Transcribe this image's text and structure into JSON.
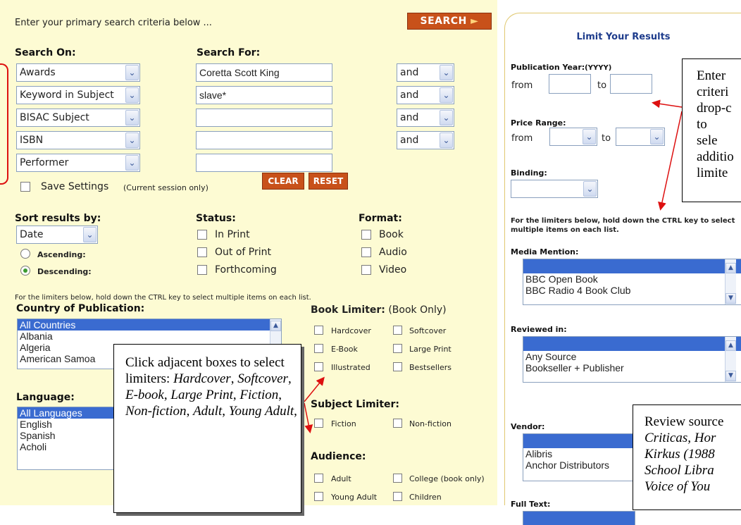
{
  "main": {
    "instruction": "Enter your primary search criteria below ...",
    "search_button": "SEARCH",
    "search_on_header": "Search On:",
    "search_for_header": "Search For:",
    "search_on": [
      "Awards",
      "Keyword in Subject",
      "BISAC Subject",
      "ISBN",
      "Performer"
    ],
    "search_for": [
      "Coretta Scott King",
      "slave*",
      "",
      "",
      ""
    ],
    "operators": [
      "and",
      "and",
      "and",
      "and"
    ],
    "save_settings": "Save Settings",
    "session_note": "(Current session only)",
    "clear_button": "CLEAR",
    "reset_button": "RESET",
    "sort_header": "Sort results by:",
    "sort_value": "Date",
    "ascending": "Ascending:",
    "descending": "Descending:",
    "sort_selected": "Descending",
    "status_header": "Status:",
    "status": [
      "In Print",
      "Out of Print",
      "Forthcoming"
    ],
    "format_header": "Format:",
    "format": [
      "Book",
      "Audio",
      "Video"
    ],
    "limiter_note": "For the limiters below, hold down the CTRL key to select multiple items on each list.",
    "country_header": "Country of Publication:",
    "countries": [
      "All Countries",
      "Albania",
      "Algeria",
      "American Samoa"
    ],
    "language_header": "Language:",
    "languages": [
      "All Languages",
      "English",
      "Spanish",
      "Acholi"
    ],
    "book_limiter_header": "Book Limiter:",
    "book_limiter_sub": "(Book Only)",
    "book_limiters": [
      "Hardcover",
      "Softcover",
      "E-Book",
      "Large Print",
      "Illustrated",
      "Bestsellers"
    ],
    "subject_limiter_header": "Subject Limiter:",
    "subject_limiters": [
      "Fiction",
      "Non-fiction"
    ],
    "audience_header": "Audience:",
    "audience": [
      "Adult",
      "College (book only)",
      "Young Adult",
      "Children"
    ]
  },
  "right": {
    "title": "Limit Your Results",
    "pub_year_label": "Publication Year:",
    "pub_year_format": "(YYYY)",
    "from": "from",
    "to": "to",
    "price_label": "Price Range:",
    "binding_label": "Binding:",
    "limiter_note": "For the limiters below, hold down the CTRL key to select multiple items on each list.",
    "media_header": "Media Mention:",
    "media": [
      "",
      "BBC Open Book",
      "BBC Radio 4 Book Club"
    ],
    "reviewed_header": "Reviewed in:",
    "reviewed": [
      "",
      "Any Source",
      "Bookseller + Publisher"
    ],
    "vendor_header": "Vendor:",
    "vendors": [
      "",
      "Alibris",
      "Anchor Distributors"
    ],
    "fulltext_header": "Full Text:"
  },
  "callouts": {
    "left_plain": "Click adjacent boxes to select limiters: ",
    "left_items": [
      "Hardcover",
      "Softcover",
      "E-book",
      "Large Print",
      "Fiction",
      "Non-fiction",
      "Adult",
      "Young Adult"
    ],
    "right_top": "Enter criteri drop-c to sele additio limite",
    "bottom_plain": "Review source",
    "bottom_italic": [
      "Criticas, Hor",
      "Kirkus (1988",
      "School Libra",
      "Voice of You"
    ]
  },
  "colors": {
    "panel": "#fdfbd3",
    "accent": "#c8511a",
    "selected": "#3a6bd0",
    "link": "#1e3c8c",
    "annotation": "#dd1010"
  }
}
